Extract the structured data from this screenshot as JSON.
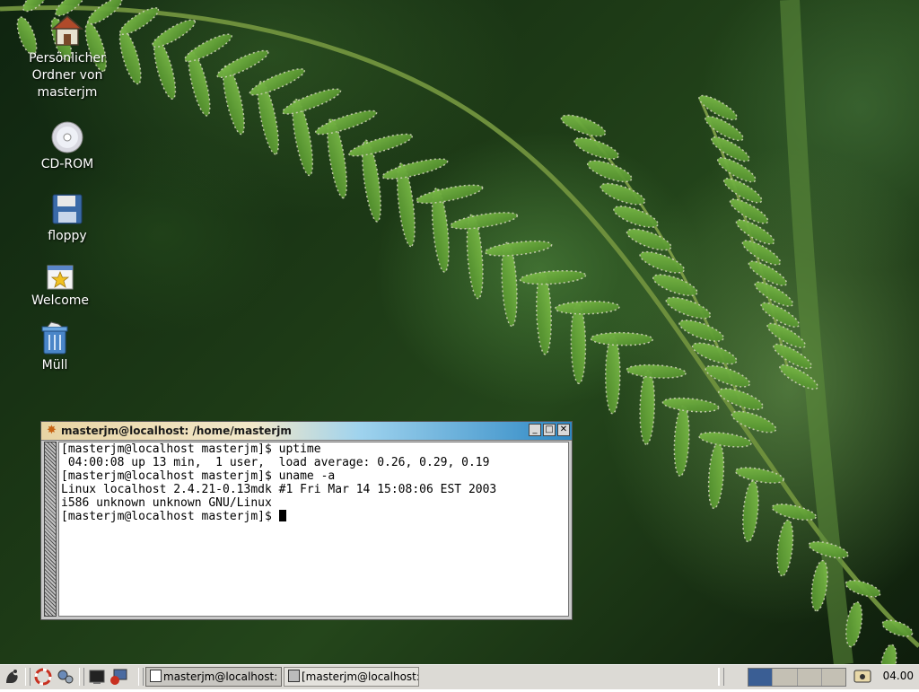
{
  "desktop": {
    "icons": [
      {
        "label": "Persönlicher Ordner von masterjm",
        "icon": "home-folder-icon"
      },
      {
        "label": "CD-ROM",
        "icon": "cdrom-icon"
      },
      {
        "label": "floppy",
        "icon": "floppy-icon"
      },
      {
        "label": "Welcome",
        "icon": "welcome-icon"
      },
      {
        "label": "Müll",
        "icon": "trash-icon"
      }
    ]
  },
  "terminal": {
    "title": "masterjm@localhost: /home/masterjm",
    "lines": [
      "[masterjm@localhost masterjm]$ uptime",
      " 04:00:08 up 13 min,  1 user,  load average: 0.26, 0.29, 0.19",
      "[masterjm@localhost masterjm]$ uname -a",
      "Linux localhost 2.4.21-0.13mdk #1 Fri Mar 14 15:08:06 EST 2003",
      "i586 unknown unknown GNU/Linux",
      "[masterjm@localhost masterjm]$ "
    ],
    "buttons": {
      "minimize": "_",
      "maximize": "□",
      "close": "✕"
    }
  },
  "taskbar": {
    "launchers": [
      "main-menu-icon",
      "help-icon",
      "settings-icon",
      "terminal-icon",
      "remote-icon"
    ],
    "tasks": [
      {
        "label": "masterjm@localhost:",
        "active": true
      },
      {
        "label": "[masterjm@localhost:",
        "active": false
      }
    ],
    "clock": "04.00",
    "colors": {
      "taskbar_bg": "#dcdad5",
      "pager_current": "#3a5e94"
    }
  }
}
